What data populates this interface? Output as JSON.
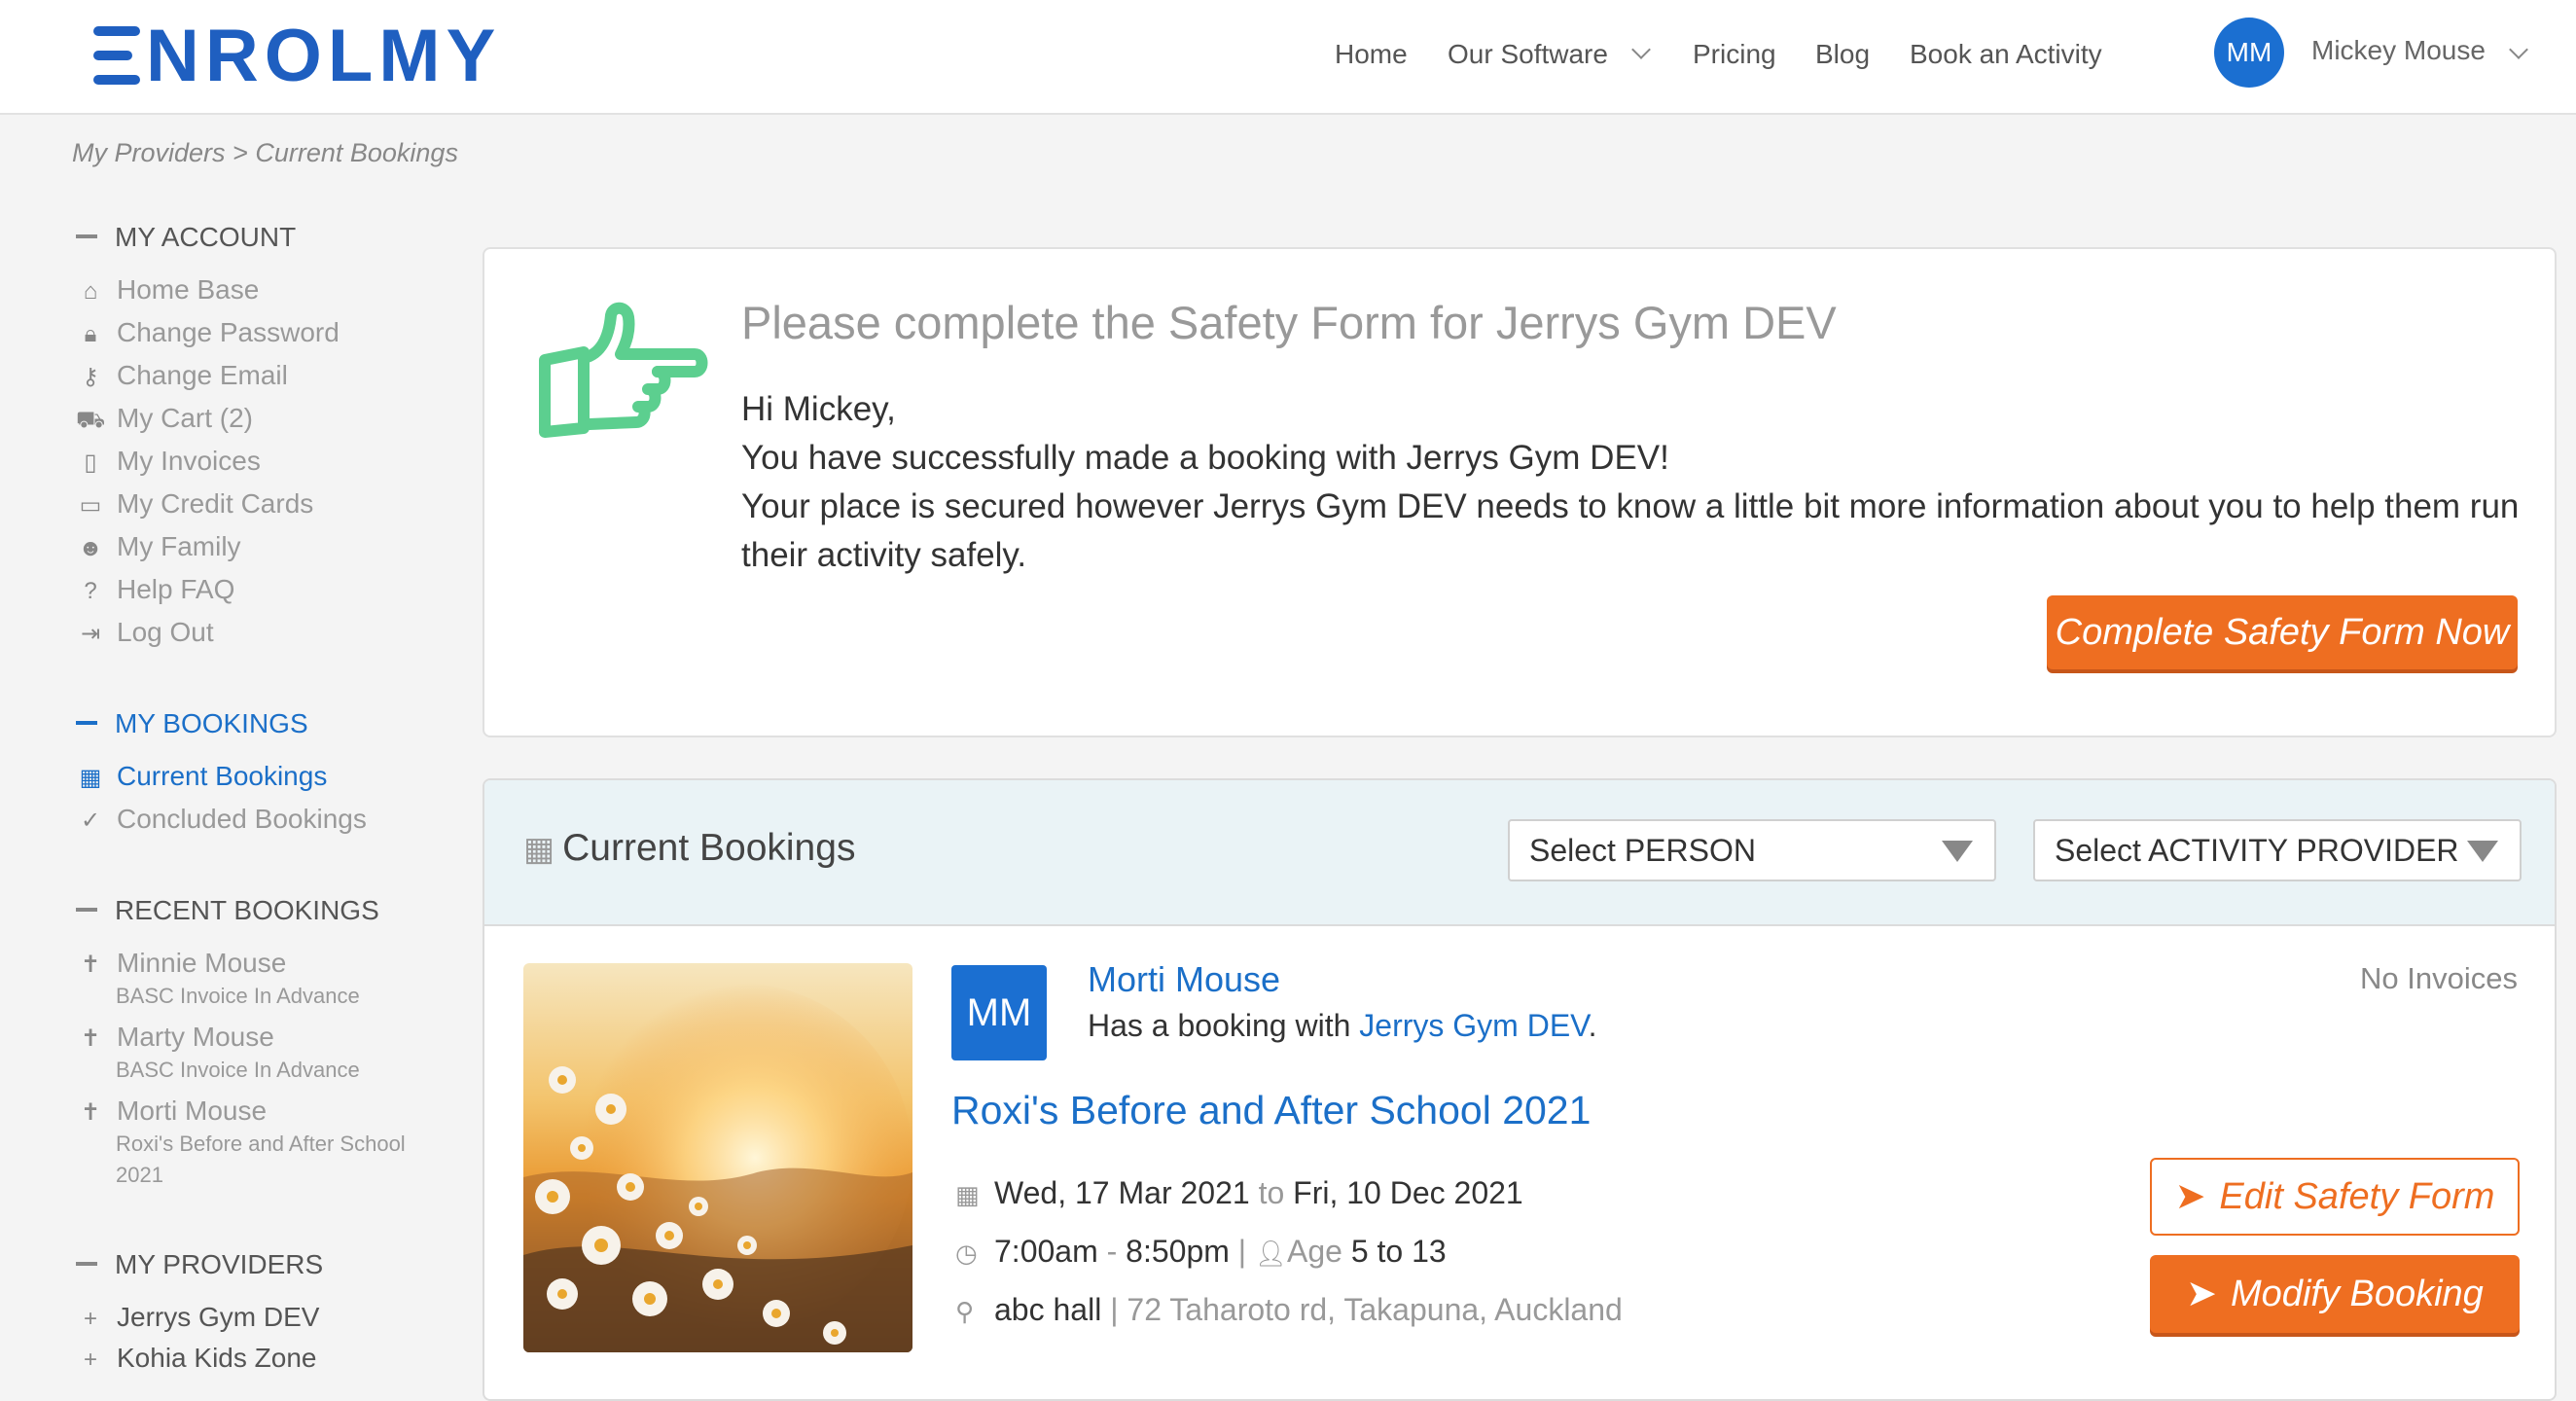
{
  "header": {
    "logo_text": "NROLMY",
    "nav": [
      {
        "label": "Home"
      },
      {
        "label": "Our Software"
      },
      {
        "label": "Pricing"
      },
      {
        "label": "Blog"
      },
      {
        "label": "Book an Activity"
      }
    ],
    "user": {
      "initials": "MM",
      "name": "Mickey Mouse"
    }
  },
  "breadcrumb": {
    "part1": "My Providers",
    "sep": ">",
    "part2": "Current Bookings"
  },
  "sidebar": {
    "account": {
      "heading": "MY ACCOUNT",
      "items": [
        {
          "label": "Home Base",
          "icon": "home-icon"
        },
        {
          "label": "Change Password",
          "icon": "lock-icon"
        },
        {
          "label": "Change Email",
          "icon": "key-icon"
        },
        {
          "label": "My Cart (2)",
          "icon": "cart-icon"
        },
        {
          "label": "My Invoices",
          "icon": "document-icon"
        },
        {
          "label": "My Credit Cards",
          "icon": "credit-card-icon"
        },
        {
          "label": "My Family",
          "icon": "family-icon"
        },
        {
          "label": "Help FAQ",
          "icon": "question-icon"
        },
        {
          "label": "Log Out",
          "icon": "logout-icon"
        }
      ]
    },
    "bookings": {
      "heading": "MY BOOKINGS",
      "items": [
        {
          "label": "Current Bookings",
          "icon": "calendar-icon"
        },
        {
          "label": "Concluded Bookings",
          "icon": "check-circle-icon"
        }
      ]
    },
    "recent": {
      "heading": "RECENT BOOKINGS",
      "items": [
        {
          "label": "Minnie Mouse",
          "sub": "BASC Invoice In Advance"
        },
        {
          "label": "Marty Mouse",
          "sub": "BASC Invoice In Advance"
        },
        {
          "label": "Morti Mouse",
          "sub1": "Roxi's Before and After School",
          "sub2": "2021"
        }
      ]
    },
    "providers": {
      "heading": "MY PROVIDERS",
      "items": [
        {
          "label": "Jerrys Gym DEV"
        },
        {
          "label": "Kohia Kids Zone"
        }
      ]
    }
  },
  "notice": {
    "title": "Please complete the Safety Form for Jerrys Gym DEV",
    "line1": "Hi Mickey,",
    "line2": "You have successfully made a booking with Jerrys Gym DEV!",
    "line3": "Your place is secured however Jerrys Gym DEV needs to know a little bit more information about you to help them run their activity safely.",
    "button": "Complete Safety Form Now",
    "accent": "#5ccf8f"
  },
  "bookings": {
    "title": "Current Bookings",
    "select_person": "Select PERSON",
    "select_provider": "Select ACTIVITY PROVIDER",
    "item": {
      "initials": "MM",
      "person": "Morti Mouse",
      "has_booking": "Has a booking with",
      "provider": "Jerrys Gym DEV",
      "period": ".",
      "activity": "Roxi's Before and After School 2021",
      "date_from": "Wed, 17 Mar 2021",
      "date_to_word": "to",
      "date_to": "Fri, 10 Dec 2021",
      "time_from": "7:00am",
      "time_sep": "-",
      "time_to": "8:50pm",
      "pipe": "|",
      "age_label": "Age",
      "age_value": "5 to 13",
      "venue": "abc hall",
      "address": "| 72 Taharoto rd, Takapuna, Auckland",
      "no_invoices": "No Invoices",
      "edit_button": "Edit Safety Form",
      "modify_button": "Modify Booking"
    }
  },
  "colors": {
    "brand": "#1f5fc0",
    "accent_orange": "#ee6e21",
    "link": "#1b6fc8"
  }
}
